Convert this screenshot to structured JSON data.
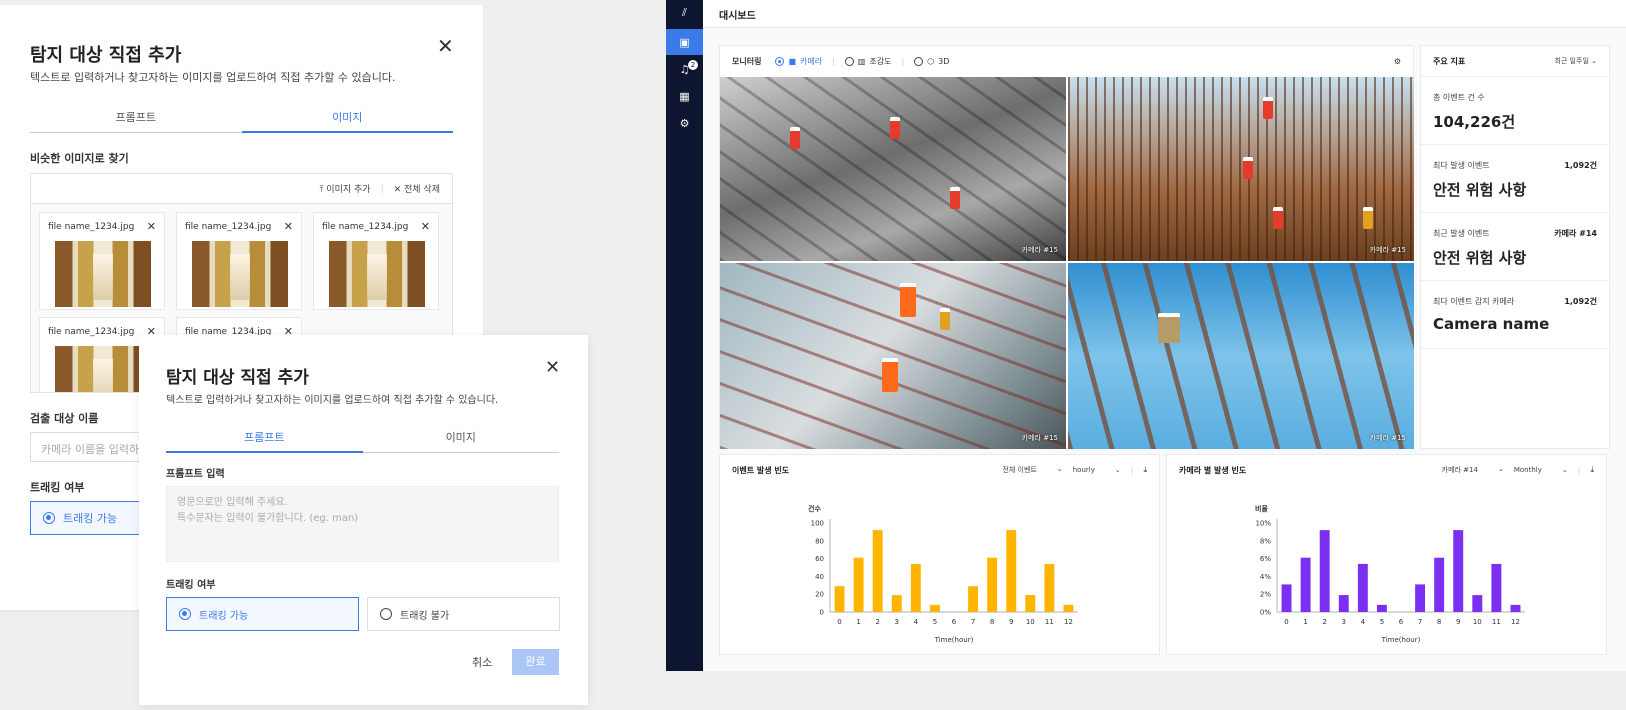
{
  "dialog_image": {
    "title": "탐지 대상 직접 추가",
    "desc": "텍스트로 입력하거나 찾고자하는 이미지를 업로드하여 직접 추가할 수 있습니다.",
    "tabs": [
      "프롬프트",
      "이미지"
    ],
    "section": "비슷한 이미지로 찾기",
    "add_image": "이미지 추가",
    "delete_all": "전체 삭제",
    "files": [
      "file name_1234.jpg",
      "file name_1234.jpg",
      "file name_1234.jpg",
      "file name_1234.jpg",
      "file name_1234.jpg"
    ],
    "name_label": "검출 대상 이름",
    "name_placeholder": "카메라 이름을 입력하",
    "tracking_label": "트래킹 여부",
    "tracking_on": "트래킹 가능"
  },
  "dialog_prompt": {
    "title": "탐지 대상 직접 추가",
    "desc": "텍스트로 입력하거나 찾고자하는 이미지를 업로드하여 직접 추가할 수 있습니다.",
    "tabs": [
      "프롬프트",
      "이미지"
    ],
    "prompt_label": "프롬프트 입력",
    "prompt_placeholder_1": "영문으로만 입력해 주세요.",
    "prompt_placeholder_2": "특수문자는 입력이 불가합니다. (eg. man)",
    "tracking_label": "트래킹 여부",
    "tracking_on": "트래킹 가능",
    "tracking_off": "트래킹 불가",
    "cancel": "취소",
    "done": "완료"
  },
  "dashboard": {
    "title": "대시보드",
    "notif_count": "2",
    "monitoring": {
      "label": "모니터링",
      "options": [
        "카메라",
        "조감도",
        "3D"
      ],
      "selected": "카메라",
      "cameras": [
        "카메라 #15",
        "카메라 #15",
        "카메라 #15",
        "카메라 #15"
      ]
    },
    "kpi": {
      "title": "주요 지표",
      "period": "최근 일주일",
      "items": [
        {
          "label": "총 이벤트 건 수",
          "right": "",
          "value": "104,226건"
        },
        {
          "label": "최다 발생 이벤트",
          "right": "1,092건",
          "value": "안전 위험 사항"
        },
        {
          "label": "최근 발생 이벤트",
          "right": "카메라 #14",
          "value": "안전 위험 사항"
        },
        {
          "label": "최다 이벤트 감지 카메라",
          "right": "1,092건",
          "value": "Camera name"
        }
      ]
    },
    "charts_head": [
      {
        "title": "이벤트 발생 빈도",
        "filter": "전체 이벤트",
        "interval": "hourly"
      },
      {
        "title": "카메라 별 발생 빈도",
        "filter": "카메라 #14",
        "interval": "Monthly"
      }
    ]
  },
  "chart_data": [
    {
      "type": "bar",
      "ylabel": "건수",
      "xlabel": "Time(hour)",
      "categories": [
        "0",
        "1",
        "2",
        "3",
        "4",
        "5",
        "6",
        "7",
        "8",
        "9",
        "10",
        "11",
        "12"
      ],
      "values": [
        29,
        61,
        92,
        19,
        54,
        8,
        0,
        29,
        61,
        92,
        19,
        54,
        8
      ],
      "ylim": [
        0,
        100
      ],
      "yticks": [
        "0",
        "20",
        "40",
        "60",
        "80",
        "100"
      ],
      "color": "#ffb400"
    },
    {
      "type": "bar",
      "ylabel": "비율",
      "xlabel": "Time(hour)",
      "categories": [
        "0",
        "1",
        "2",
        "3",
        "4",
        "5",
        "6",
        "7",
        "8",
        "9",
        "10",
        "11",
        "12"
      ],
      "values": [
        3.1,
        6.1,
        9.2,
        1.9,
        5.4,
        0.8,
        0,
        3.1,
        6.1,
        9.2,
        1.9,
        5.4,
        0.8
      ],
      "ylim": [
        0,
        10
      ],
      "yticks": [
        "0%",
        "2%",
        "4%",
        "6%",
        "8%",
        "10%"
      ],
      "color": "#7b2ff0"
    }
  ]
}
